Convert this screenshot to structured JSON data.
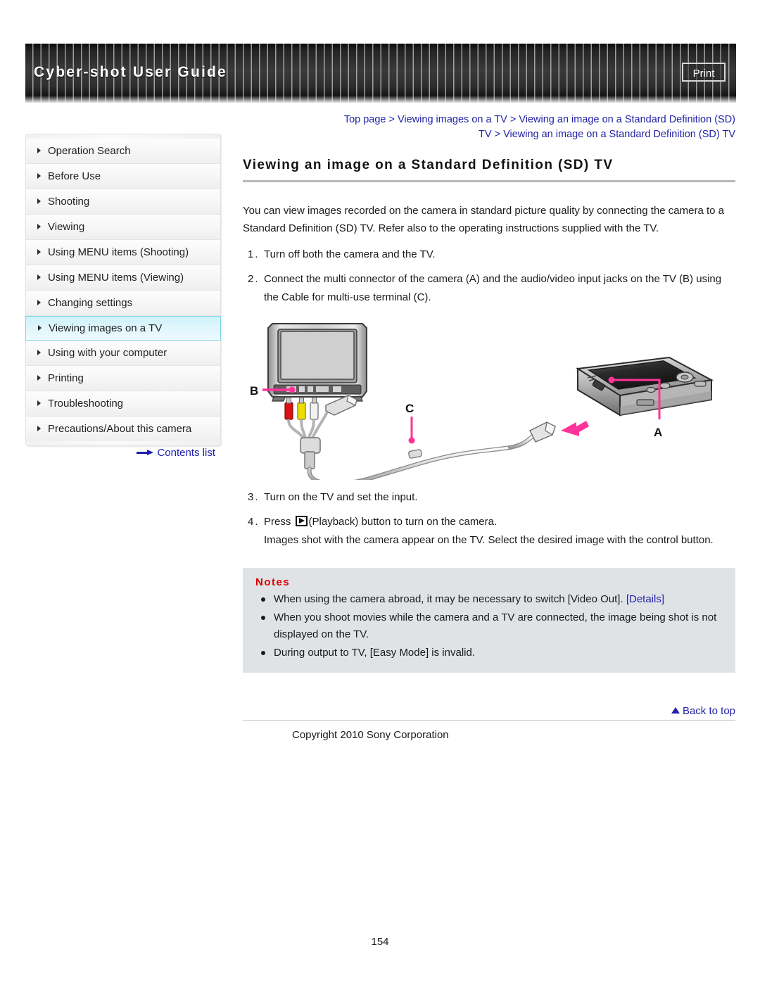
{
  "header": {
    "title": "Cyber-shot User Guide",
    "print_label": "Print"
  },
  "sidebar": {
    "items": [
      {
        "label": "Operation Search",
        "active": false
      },
      {
        "label": "Before Use",
        "active": false
      },
      {
        "label": "Shooting",
        "active": false
      },
      {
        "label": "Viewing",
        "active": false
      },
      {
        "label": "Using MENU items (Shooting)",
        "active": false
      },
      {
        "label": "Using MENU items (Viewing)",
        "active": false
      },
      {
        "label": "Changing settings",
        "active": false
      },
      {
        "label": "Viewing images on a TV",
        "active": true
      },
      {
        "label": "Using with your computer",
        "active": false
      },
      {
        "label": "Printing",
        "active": false
      },
      {
        "label": "Troubleshooting",
        "active": false
      },
      {
        "label": "Precautions/About this camera",
        "active": false
      }
    ],
    "contents_link": "Contents list"
  },
  "main": {
    "breadcrumb_line1": "Top page > Viewing images on a TV > Viewing an image on a Standard Definition (SD)",
    "breadcrumb_line2": "TV > Viewing an image on a Standard Definition (SD) TV",
    "title": "Viewing an image on a Standard Definition (SD) TV",
    "intro": "You can view images recorded on the camera in standard picture quality by connecting the camera to a Standard Definition (SD) TV. Refer also to the operating instructions supplied with the TV.",
    "steps": [
      {
        "num": "1.",
        "text": "Turn off both the camera and the TV."
      },
      {
        "num": "2.",
        "text": "Connect the multi connector of the camera (A) and the audio/video input jacks on the TV (B) using the Cable for multi-use terminal (C)."
      },
      {
        "num": "3.",
        "text": "Turn on the TV and set the input."
      }
    ],
    "step4": {
      "num": "4.",
      "text_before": "Press",
      "text_after": "(Playback) button to turn on the camera.",
      "detail": "Images shot with the camera appear on the TV. Select the desired image with the control button."
    },
    "diagram": {
      "label_a": "A",
      "label_b": "B",
      "label_c": "C",
      "caption_semantics": "TV connected to digital camera with multi-use terminal AV cable",
      "callout_color": "#ff3399",
      "plug_colors": [
        "#dd1111",
        "#eedd00",
        "#f2f2f2"
      ]
    },
    "notes": {
      "title": "Notes",
      "items": [
        {
          "text": "When using the camera abroad, it may be necessary to switch [Video Out].",
          "link": "[Details]"
        },
        {
          "text": "When you shoot movies while the camera and a TV are connected, the image being shot is not displayed on the TV.",
          "link": ""
        },
        {
          "text": "During output to TV, [Easy Mode] is invalid.",
          "link": ""
        }
      ]
    }
  },
  "footer": {
    "back_to_top": "Back to top",
    "copyright": "Copyright 2010 Sony Corporation",
    "page_number": "154"
  }
}
